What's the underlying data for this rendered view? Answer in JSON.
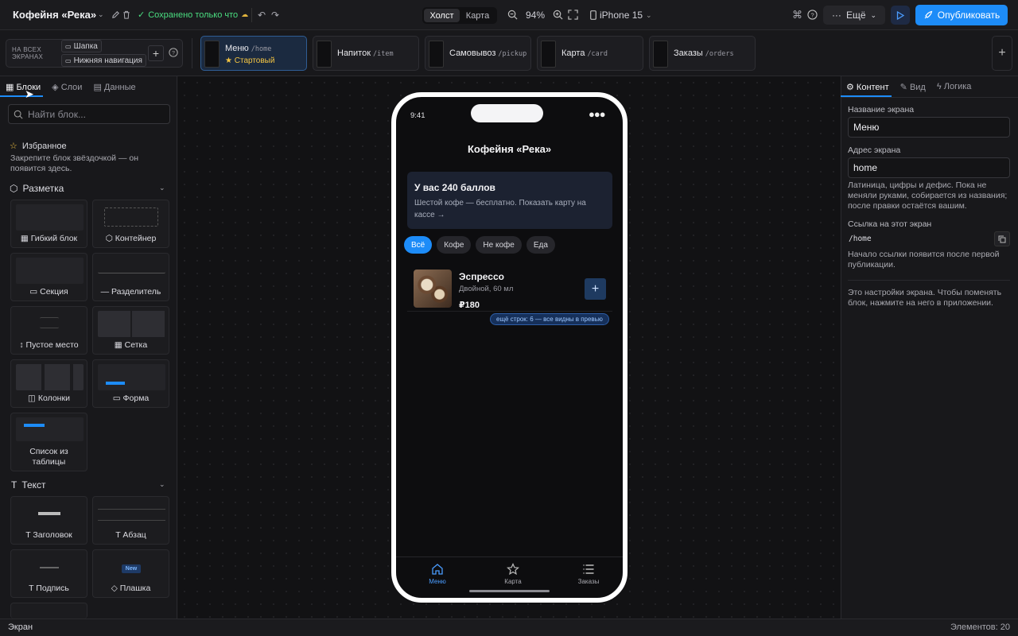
{
  "topbar": {
    "app_title": "Кофейня «Река»",
    "saved_status": "Сохранено только что",
    "view_tabs": [
      "Холст",
      "Карта"
    ],
    "zoom": "94%",
    "device": "iPhone 15",
    "more_label": "Ещё",
    "publish_label": "Опубликовать"
  },
  "screens_bar": {
    "all_screens_label": "НА ВСЕХ ЭКРАНАХ",
    "shared_parts": [
      "Шапка",
      "Нижняя навигация"
    ],
    "screens": [
      {
        "name": "Меню",
        "path": "/home",
        "badge": "Стартовый"
      },
      {
        "name": "Напиток",
        "path": "/item"
      },
      {
        "name": "Самовывоз",
        "path": "/pickup"
      },
      {
        "name": "Карта",
        "path": "/card"
      },
      {
        "name": "Заказы",
        "path": "/orders"
      }
    ]
  },
  "left_panel": {
    "tabs": [
      "Блоки",
      "Слои",
      "Данные"
    ],
    "search_placeholder": "Найти блок...",
    "favorites_title": "Избранное",
    "favorites_hint": "Закрепите блок звёздочкой — он появится здесь.",
    "sections": [
      {
        "title": "Разметка",
        "blocks": [
          "Гибкий блок",
          "Контейнер",
          "Секция",
          "Разделитель",
          "Пустое место",
          "Сетка",
          "Колонки",
          "Форма",
          "Список из таблицы"
        ]
      },
      {
        "title": "Текст",
        "blocks": [
          "Заголовок",
          "Абзац",
          "Подпись",
          "Плашка"
        ]
      }
    ],
    "badge_new": "New"
  },
  "phone": {
    "time": "9:41",
    "header_title": "Кофейня «Река»",
    "points_title": "У вас 240 баллов",
    "points_text": "Шестой кофе — бесплатно. Показать карту на кассе →",
    "chips": [
      "Всё",
      "Кофе",
      "Не кофе",
      "Еда"
    ],
    "item": {
      "name": "Эспрессо",
      "desc": "Двойной, 60 мл",
      "price": "₽180"
    },
    "more_rows": "ещё строк: 6 — все видны в превью",
    "nav": [
      "Меню",
      "Карта",
      "Заказы"
    ]
  },
  "right_panel": {
    "tabs": [
      "Контент",
      "Вид",
      "Логика"
    ],
    "screen_name_label": "Название экрана",
    "screen_name_value": "Меню",
    "screen_address_label": "Адрес экрана",
    "screen_address_value": "home",
    "address_hint": "Латиница, цифры и дефис. Пока не меняли руками, собирается из названия; после правки остаётся вашим.",
    "link_label": "Ссылка на этот экран",
    "link_value": "/home",
    "link_hint": "Начало ссылки появится после первой публикации.",
    "settings_hint": "Это настройки экрана. Чтобы поменять блок, нажмите на него в приложении."
  },
  "statusbar": {
    "left": "Экран",
    "right": "Элементов: 20"
  },
  "colors": {
    "accent": "#1d8cf8",
    "saved": "#4ade80",
    "star": "#f5c542"
  }
}
